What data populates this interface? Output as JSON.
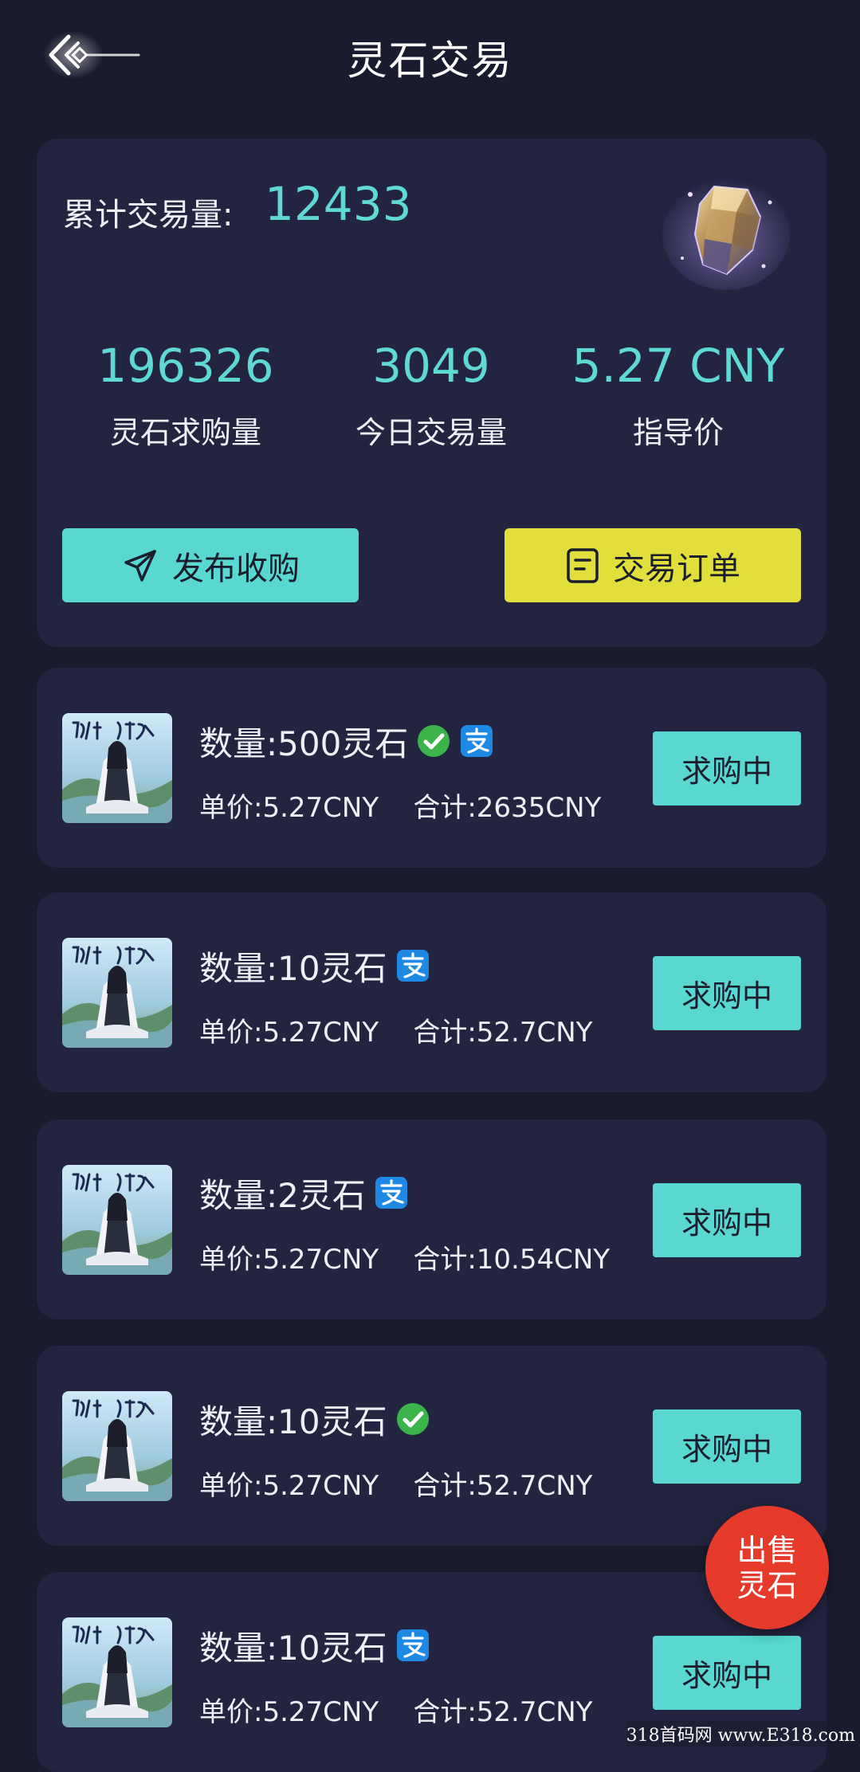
{
  "header": {
    "title": "灵石交易",
    "back_icon": "back-arrow-icon"
  },
  "summary": {
    "total_label": "累计交易量:",
    "total_value": "12433",
    "stats": [
      {
        "value": "196326",
        "label": "灵石求购量"
      },
      {
        "value": "3049",
        "label": "今日交易量"
      },
      {
        "value": "5.27 CNY",
        "label": "指导价"
      }
    ],
    "publish_button": "发布收购",
    "orders_button": "交易订单"
  },
  "orders": [
    {
      "quantity": "数量:500灵石",
      "price": "单价:5.27CNY",
      "total": "合计:2635CNY",
      "payments": [
        "wechat",
        "alipay"
      ],
      "status": "求购中"
    },
    {
      "quantity": "数量:10灵石",
      "price": "单价:5.27CNY",
      "total": "合计:52.7CNY",
      "payments": [
        "alipay"
      ],
      "status": "求购中"
    },
    {
      "quantity": "数量:2灵石",
      "price": "单价:5.27CNY",
      "total": "合计:10.54CNY",
      "payments": [
        "alipay"
      ],
      "status": "求购中"
    },
    {
      "quantity": "数量:10灵石",
      "price": "单价:5.27CNY",
      "total": "合计:52.7CNY",
      "payments": [
        "wechat"
      ],
      "status": "求购中"
    },
    {
      "quantity": "数量:10灵石",
      "price": "单价:5.27CNY",
      "total": "合计:52.7CNY",
      "payments": [
        "alipay"
      ],
      "status": "求购中"
    }
  ],
  "fab": {
    "line1": "出售",
    "line2": "灵石"
  },
  "watermark": "318首码网 www.E318.com",
  "colors": {
    "background": "#1a1b2e",
    "card": "#232440",
    "accent_cyan": "#58d8d1",
    "accent_yellow": "#e2df3d",
    "fab_red": "#e63a2a",
    "wechat_green": "#3bb54a",
    "alipay_blue": "#1e88e5"
  }
}
